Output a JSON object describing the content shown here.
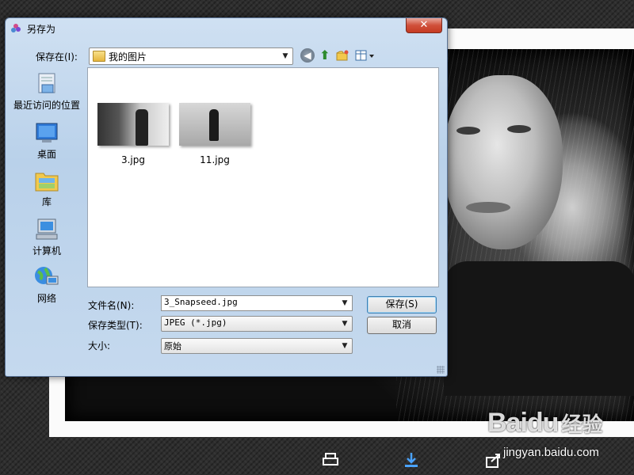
{
  "dialog": {
    "title": "另存为",
    "save_in_label": "保存在(I):",
    "location": "我的图片"
  },
  "places": [
    {
      "label": "最近访问的位置",
      "icon": "recent-places-icon"
    },
    {
      "label": "桌面",
      "icon": "desktop-icon"
    },
    {
      "label": "库",
      "icon": "libraries-icon"
    },
    {
      "label": "计算机",
      "icon": "computer-icon"
    },
    {
      "label": "网络",
      "icon": "network-icon"
    }
  ],
  "files": [
    {
      "name": "3.jpg"
    },
    {
      "name": "11.jpg"
    }
  ],
  "form": {
    "filename_label": "文件名(N):",
    "filename_value": "3_Snapseed.jpg",
    "filetype_label": "保存类型(T):",
    "filetype_value": "JPEG (*.jpg)",
    "size_label": "大小:",
    "size_value": "原始"
  },
  "buttons": {
    "save": "保存(S)",
    "cancel": "取消"
  },
  "watermark": {
    "logo": "Baidu",
    "logo_cn": "经验",
    "url": "jingyan.baidu.com"
  },
  "colors": {
    "close_red": "#c53a22",
    "dialog_chrome": "#b9d1ea",
    "default_button_border": "#3c7fb1"
  }
}
